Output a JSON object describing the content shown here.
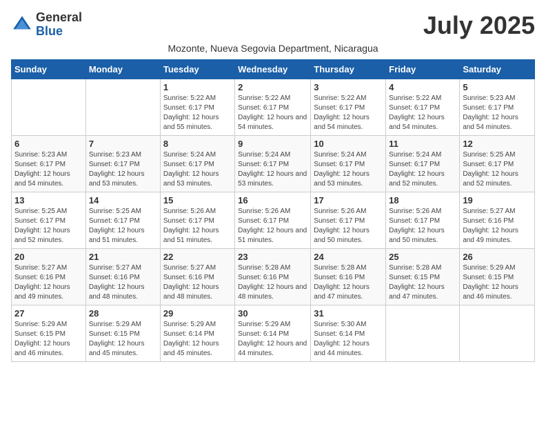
{
  "header": {
    "logo_general": "General",
    "logo_blue": "Blue",
    "month_year": "July 2025",
    "location": "Mozonte, Nueva Segovia Department, Nicaragua"
  },
  "weekdays": [
    "Sunday",
    "Monday",
    "Tuesday",
    "Wednesday",
    "Thursday",
    "Friday",
    "Saturday"
  ],
  "weeks": [
    [
      {
        "day": "",
        "info": ""
      },
      {
        "day": "",
        "info": ""
      },
      {
        "day": "1",
        "info": "Sunrise: 5:22 AM\nSunset: 6:17 PM\nDaylight: 12 hours and 55 minutes."
      },
      {
        "day": "2",
        "info": "Sunrise: 5:22 AM\nSunset: 6:17 PM\nDaylight: 12 hours and 54 minutes."
      },
      {
        "day": "3",
        "info": "Sunrise: 5:22 AM\nSunset: 6:17 PM\nDaylight: 12 hours and 54 minutes."
      },
      {
        "day": "4",
        "info": "Sunrise: 5:22 AM\nSunset: 6:17 PM\nDaylight: 12 hours and 54 minutes."
      },
      {
        "day": "5",
        "info": "Sunrise: 5:23 AM\nSunset: 6:17 PM\nDaylight: 12 hours and 54 minutes."
      }
    ],
    [
      {
        "day": "6",
        "info": "Sunrise: 5:23 AM\nSunset: 6:17 PM\nDaylight: 12 hours and 54 minutes."
      },
      {
        "day": "7",
        "info": "Sunrise: 5:23 AM\nSunset: 6:17 PM\nDaylight: 12 hours and 53 minutes."
      },
      {
        "day": "8",
        "info": "Sunrise: 5:24 AM\nSunset: 6:17 PM\nDaylight: 12 hours and 53 minutes."
      },
      {
        "day": "9",
        "info": "Sunrise: 5:24 AM\nSunset: 6:17 PM\nDaylight: 12 hours and 53 minutes."
      },
      {
        "day": "10",
        "info": "Sunrise: 5:24 AM\nSunset: 6:17 PM\nDaylight: 12 hours and 53 minutes."
      },
      {
        "day": "11",
        "info": "Sunrise: 5:24 AM\nSunset: 6:17 PM\nDaylight: 12 hours and 52 minutes."
      },
      {
        "day": "12",
        "info": "Sunrise: 5:25 AM\nSunset: 6:17 PM\nDaylight: 12 hours and 52 minutes."
      }
    ],
    [
      {
        "day": "13",
        "info": "Sunrise: 5:25 AM\nSunset: 6:17 PM\nDaylight: 12 hours and 52 minutes."
      },
      {
        "day": "14",
        "info": "Sunrise: 5:25 AM\nSunset: 6:17 PM\nDaylight: 12 hours and 51 minutes."
      },
      {
        "day": "15",
        "info": "Sunrise: 5:26 AM\nSunset: 6:17 PM\nDaylight: 12 hours and 51 minutes."
      },
      {
        "day": "16",
        "info": "Sunrise: 5:26 AM\nSunset: 6:17 PM\nDaylight: 12 hours and 51 minutes."
      },
      {
        "day": "17",
        "info": "Sunrise: 5:26 AM\nSunset: 6:17 PM\nDaylight: 12 hours and 50 minutes."
      },
      {
        "day": "18",
        "info": "Sunrise: 5:26 AM\nSunset: 6:17 PM\nDaylight: 12 hours and 50 minutes."
      },
      {
        "day": "19",
        "info": "Sunrise: 5:27 AM\nSunset: 6:16 PM\nDaylight: 12 hours and 49 minutes."
      }
    ],
    [
      {
        "day": "20",
        "info": "Sunrise: 5:27 AM\nSunset: 6:16 PM\nDaylight: 12 hours and 49 minutes."
      },
      {
        "day": "21",
        "info": "Sunrise: 5:27 AM\nSunset: 6:16 PM\nDaylight: 12 hours and 48 minutes."
      },
      {
        "day": "22",
        "info": "Sunrise: 5:27 AM\nSunset: 6:16 PM\nDaylight: 12 hours and 48 minutes."
      },
      {
        "day": "23",
        "info": "Sunrise: 5:28 AM\nSunset: 6:16 PM\nDaylight: 12 hours and 48 minutes."
      },
      {
        "day": "24",
        "info": "Sunrise: 5:28 AM\nSunset: 6:16 PM\nDaylight: 12 hours and 47 minutes."
      },
      {
        "day": "25",
        "info": "Sunrise: 5:28 AM\nSunset: 6:15 PM\nDaylight: 12 hours and 47 minutes."
      },
      {
        "day": "26",
        "info": "Sunrise: 5:29 AM\nSunset: 6:15 PM\nDaylight: 12 hours and 46 minutes."
      }
    ],
    [
      {
        "day": "27",
        "info": "Sunrise: 5:29 AM\nSunset: 6:15 PM\nDaylight: 12 hours and 46 minutes."
      },
      {
        "day": "28",
        "info": "Sunrise: 5:29 AM\nSunset: 6:15 PM\nDaylight: 12 hours and 45 minutes."
      },
      {
        "day": "29",
        "info": "Sunrise: 5:29 AM\nSunset: 6:14 PM\nDaylight: 12 hours and 45 minutes."
      },
      {
        "day": "30",
        "info": "Sunrise: 5:29 AM\nSunset: 6:14 PM\nDaylight: 12 hours and 44 minutes."
      },
      {
        "day": "31",
        "info": "Sunrise: 5:30 AM\nSunset: 6:14 PM\nDaylight: 12 hours and 44 minutes."
      },
      {
        "day": "",
        "info": ""
      },
      {
        "day": "",
        "info": ""
      }
    ]
  ]
}
